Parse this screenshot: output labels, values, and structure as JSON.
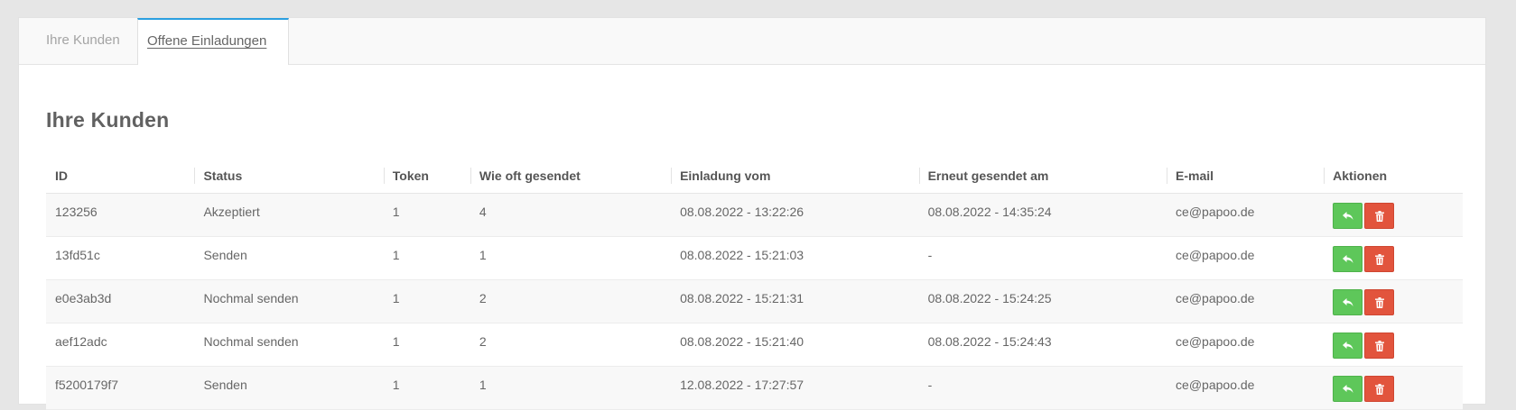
{
  "tabs": [
    {
      "label": "Ihre Kunden",
      "active": false
    },
    {
      "label": "Offene Einladungen",
      "active": true
    }
  ],
  "heading": "Ihre Kunden",
  "columns": [
    "ID",
    "Status",
    "Token",
    "Wie oft gesendet",
    "Einladung vom",
    "Erneut gesendet am",
    "E-mail",
    "Aktionen"
  ],
  "rows": [
    {
      "id": "123256",
      "status": "Akzeptiert",
      "token": "1",
      "sent_count": "4",
      "invited": "08.08.2022 - 13:22:26",
      "resent": "08.08.2022 - 14:35:24",
      "email": "ce@papoo.de"
    },
    {
      "id": "13fd51c",
      "status": "Senden",
      "token": "1",
      "sent_count": "1",
      "invited": "08.08.2022 - 15:21:03",
      "resent": "-",
      "email": "ce@papoo.de"
    },
    {
      "id": "e0e3ab3d",
      "status": "Nochmal senden",
      "token": "1",
      "sent_count": "2",
      "invited": "08.08.2022 - 15:21:31",
      "resent": "08.08.2022 - 15:24:25",
      "email": "ce@papoo.de"
    },
    {
      "id": "aef12adc",
      "status": "Nochmal senden",
      "token": "1",
      "sent_count": "2",
      "invited": "08.08.2022 - 15:21:40",
      "resent": "08.08.2022 - 15:24:43",
      "email": "ce@papoo.de"
    },
    {
      "id": "f5200179f7",
      "status": "Senden",
      "token": "1",
      "sent_count": "1",
      "invited": "12.08.2022 - 17:27:57",
      "resent": "-",
      "email": "ce@papoo.de"
    }
  ],
  "actions": {
    "resend_icon": "reply-icon",
    "delete_icon": "trash-icon",
    "resend_color": "#5ec75a",
    "delete_color": "#e2543d"
  },
  "colors": {
    "active_tab_accent": "#2b9fe0",
    "background": "#e6e6e6"
  }
}
